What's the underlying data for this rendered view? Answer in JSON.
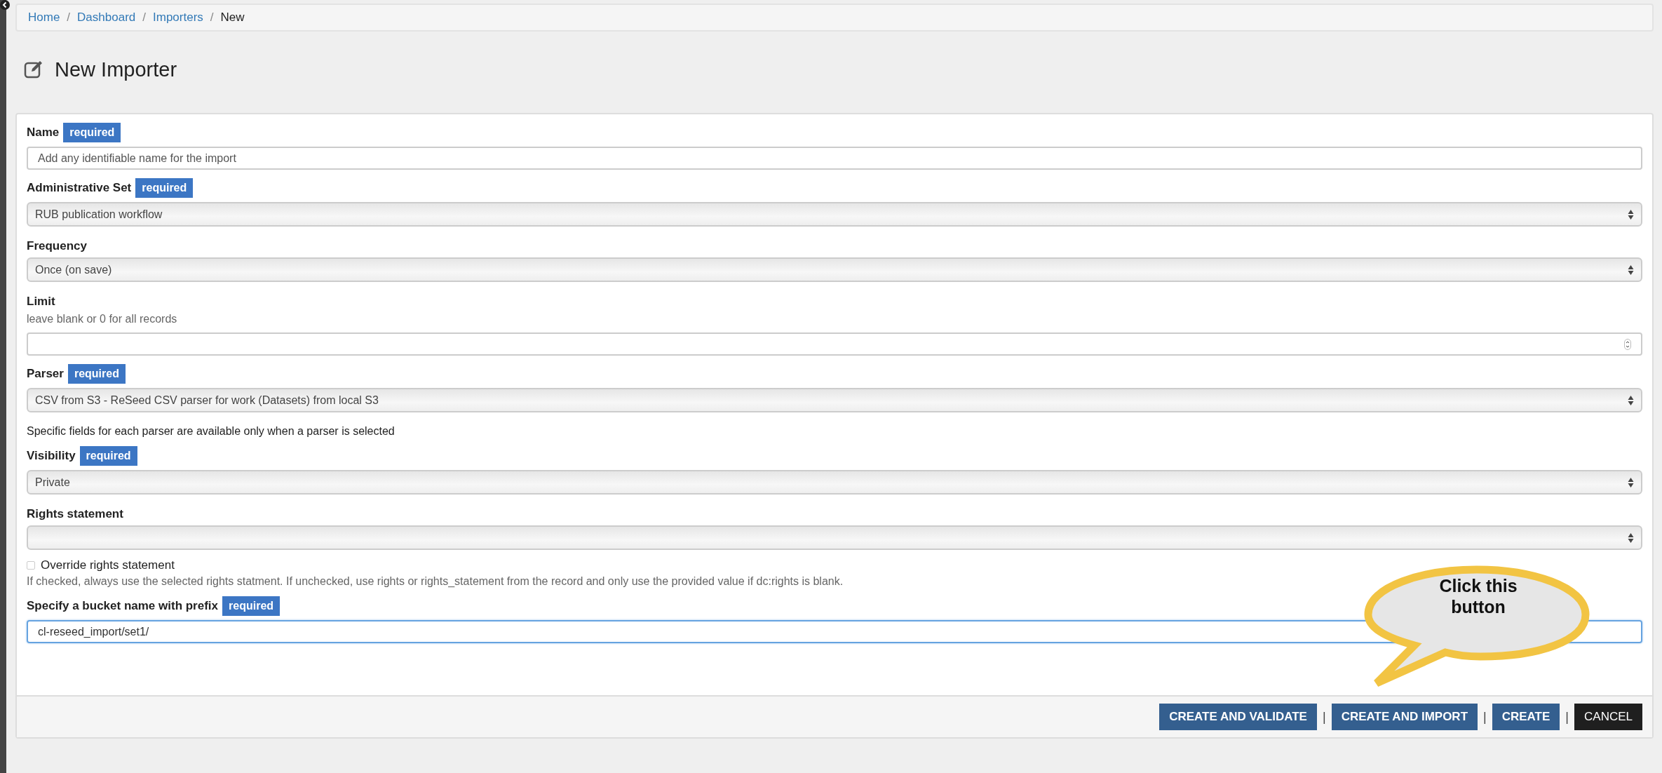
{
  "breadcrumb": [
    {
      "label": "Home",
      "current": false
    },
    {
      "label": "Dashboard",
      "current": false
    },
    {
      "label": "Importers",
      "current": false
    },
    {
      "label": "New",
      "current": true
    }
  ],
  "breadcrumb_separator": "/",
  "title": "New Importer",
  "fields": [
    {
      "kind": "text",
      "label": "Name",
      "badge": "required",
      "placeholder": "Add any identifiable name for the import"
    },
    {
      "kind": "select",
      "label": "Administrative Set",
      "badge": "required",
      "value": "RUB publication workflow"
    },
    {
      "kind": "select",
      "label": "Frequency",
      "value": "Once (on save)"
    },
    {
      "kind": "number",
      "label": "Limit",
      "help_above": "leave blank or 0 for all records"
    },
    {
      "kind": "select",
      "label": "Parser",
      "badge": "required",
      "value": "CSV from S3 - ReSeed CSV parser for work (Datasets) from local S3",
      "help_below": "Specific fields for each parser are available only when a parser is selected"
    },
    {
      "kind": "select",
      "label": "Visibility",
      "badge": "required",
      "value": "Private"
    },
    {
      "kind": "select",
      "label": "Rights statement"
    },
    {
      "kind": "checkbox",
      "label": "Override rights statement",
      "checked": false,
      "help_below": "If checked, always use the selected rights statment. If unchecked, use rights or rights_statement from the record and only use the provided value if dc:rights is blank."
    },
    {
      "kind": "text",
      "label": "Specify a bucket name with prefix",
      "badge": "required",
      "value": "cl-reseed_import/set1/",
      "focused": true
    }
  ],
  "buttons": [
    {
      "label": "CREATE AND VALIDATE",
      "kind": "primary"
    },
    {
      "label": "CREATE AND IMPORT",
      "kind": "primary",
      "separator_before": "|"
    },
    {
      "label": "CREATE",
      "kind": "primary",
      "separator_before": "|"
    },
    {
      "label": "CANCEL",
      "kind": "dark",
      "separator_before": "|"
    }
  ],
  "callout": {
    "text": "Click this button"
  }
}
